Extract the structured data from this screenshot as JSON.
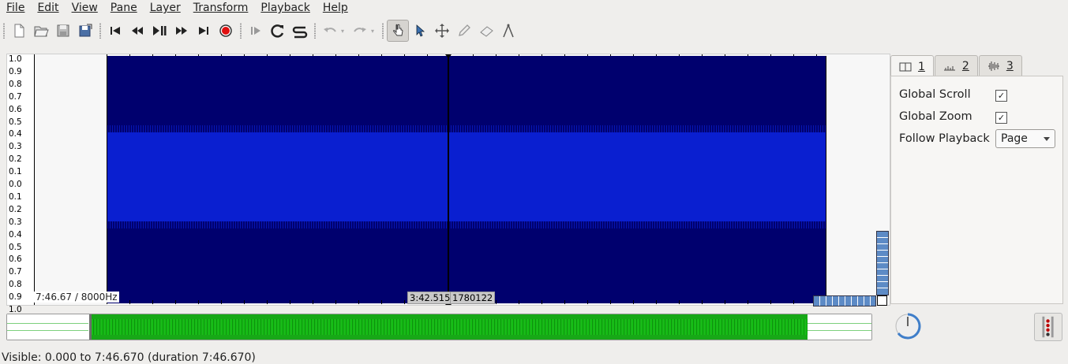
{
  "menubar": {
    "items": [
      {
        "label": "File"
      },
      {
        "label": "Edit"
      },
      {
        "label": "View"
      },
      {
        "label": "Pane"
      },
      {
        "label": "Layer"
      },
      {
        "label": "Transform"
      },
      {
        "label": "Playback"
      },
      {
        "label": "Help"
      }
    ]
  },
  "toolbar": {
    "icons": [
      "new-file-icon",
      "open-icon",
      "save-icon",
      "save-as-icon",
      "rewind-start-icon",
      "rewind-icon",
      "play-pause-icon",
      "fast-forward-icon",
      "forward-end-icon",
      "record-icon",
      "constrain-playback-icon",
      "loop-icon",
      "solo-icon",
      "undo-icon",
      "redo-icon",
      "navigate-icon",
      "select-icon",
      "move-icon",
      "draw-icon",
      "erase-icon",
      "measure-icon"
    ],
    "active_tool": "navigate"
  },
  "pane": {
    "scale_labels": [
      "1.0",
      "0.9",
      "0.8",
      "0.7",
      "0.6",
      "0.5",
      "0.4",
      "0.3",
      "0.2",
      "0.1",
      "0.0",
      "0.1",
      "0.2",
      "0.3",
      "0.4",
      "0.5",
      "0.6",
      "0.7",
      "0.8",
      "0.9",
      "1.0"
    ],
    "info": "7:46.67 / 8000Hz",
    "cursor_time": "3:42.515",
    "cursor_frame": "1780122",
    "colors": {
      "waveform_bg": "#00006e",
      "waveform_fg": "#0a1fd0"
    }
  },
  "props": {
    "tabs": [
      {
        "label": "1",
        "icon": "pane-icon"
      },
      {
        "label": "2",
        "icon": "ruler-icon"
      },
      {
        "label": "3",
        "icon": "waveform-icon"
      }
    ],
    "global_scroll_label": "Global Scroll",
    "global_scroll_checked": true,
    "global_zoom_label": "Global Zoom",
    "global_zoom_checked": true,
    "follow_playback_label": "Follow Playback",
    "follow_playback_value": "Page"
  },
  "overview": {
    "colors": {
      "waveform": "#17a817"
    }
  },
  "status": {
    "text": "Visible: 0.000 to 7:46.670 (duration 7:46.670)"
  }
}
